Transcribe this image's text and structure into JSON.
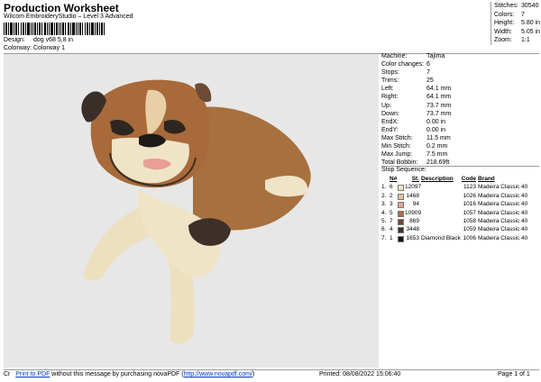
{
  "header": {
    "title": "Production Worksheet",
    "subtitle": "Wilcom EmbroideryStudio – Level 3 Advanced",
    "design_label": "Design:",
    "design_value": "dog v68 5,8 in",
    "colorway_label": "Colorway:",
    "colorway_value": "Colorway 1"
  },
  "stats": [
    {
      "label": "Stitches:",
      "value": "30540"
    },
    {
      "label": "Colors:",
      "value": "7"
    },
    {
      "label": "Height:",
      "value": "5.80 in"
    },
    {
      "label": "Width:",
      "value": "5.05 in"
    },
    {
      "label": "Zoom:",
      "value": "1:1"
    }
  ],
  "info": [
    {
      "label": "Machine:",
      "value": "Tajima"
    },
    {
      "label": "Color changes:",
      "value": "6"
    },
    {
      "label": "Stops:",
      "value": "7"
    },
    {
      "label": "Trims:",
      "value": "25"
    },
    {
      "label": "Left:",
      "value": "64.1 mm"
    },
    {
      "label": "Right:",
      "value": "64.1 mm"
    },
    {
      "label": "Up:",
      "value": "73.7 mm"
    },
    {
      "label": "Down:",
      "value": "73.7 mm"
    },
    {
      "label": "EndX:",
      "value": "0.00 in"
    },
    {
      "label": "EndY:",
      "value": "0.00 in"
    },
    {
      "label": "Max Stitch:",
      "value": "11.5 mm"
    },
    {
      "label": "Min Stitch:",
      "value": "0.2 mm"
    },
    {
      "label": "Max Jump:",
      "value": "7.5 mm"
    },
    {
      "label": "Total Bobbin:",
      "value": "218.69ft"
    }
  ],
  "sequence": {
    "title": "Stop Sequence:",
    "headers": {
      "n": "N#",
      "stitches": "St.",
      "description": "Description",
      "code": "Code",
      "brand": "Brand"
    },
    "rows": [
      {
        "stop": "1.",
        "n": "6",
        "color": "#f0e2c4",
        "stitches": "12097",
        "description": "",
        "code": "1123",
        "brand": "Madeira Classic 40"
      },
      {
        "stop": "2.",
        "n": "2",
        "color": "#e8c09a",
        "stitches": "1468",
        "description": "",
        "code": "1026",
        "brand": "Madeira Classic 40"
      },
      {
        "stop": "3.",
        "n": "3",
        "color": "#e89f98",
        "stitches": "94",
        "description": "",
        "code": "1016",
        "brand": "Madeira Classic 40"
      },
      {
        "stop": "4.",
        "n": "5",
        "color": "#b46a3c",
        "stitches": "10909",
        "description": "",
        "code": "1057",
        "brand": "Madeira Classic 40"
      },
      {
        "stop": "5.",
        "n": "7",
        "color": "#6b4a36",
        "stitches": "869",
        "description": "",
        "code": "1058",
        "brand": "Madeira Classic 40"
      },
      {
        "stop": "6.",
        "n": "4",
        "color": "#3f3029",
        "stitches": "3448",
        "description": "",
        "code": "1059",
        "brand": "Madeira Classic 40"
      },
      {
        "stop": "7.",
        "n": "1",
        "color": "#111111",
        "stitches": "1653",
        "description": "Diamond Black",
        "code": "1006",
        "brand": "Madeira Classic 40"
      }
    ]
  },
  "footer": {
    "prefix": "Cr",
    "link_text": "Print to PDF",
    "middle": " without this message by purchasing novaPDF (",
    "url": "http://www.novapdf.com/",
    "suffix": ")",
    "printed": "Printed: 08/08/2022 15:06:40",
    "page": "Page 1 of 1"
  }
}
